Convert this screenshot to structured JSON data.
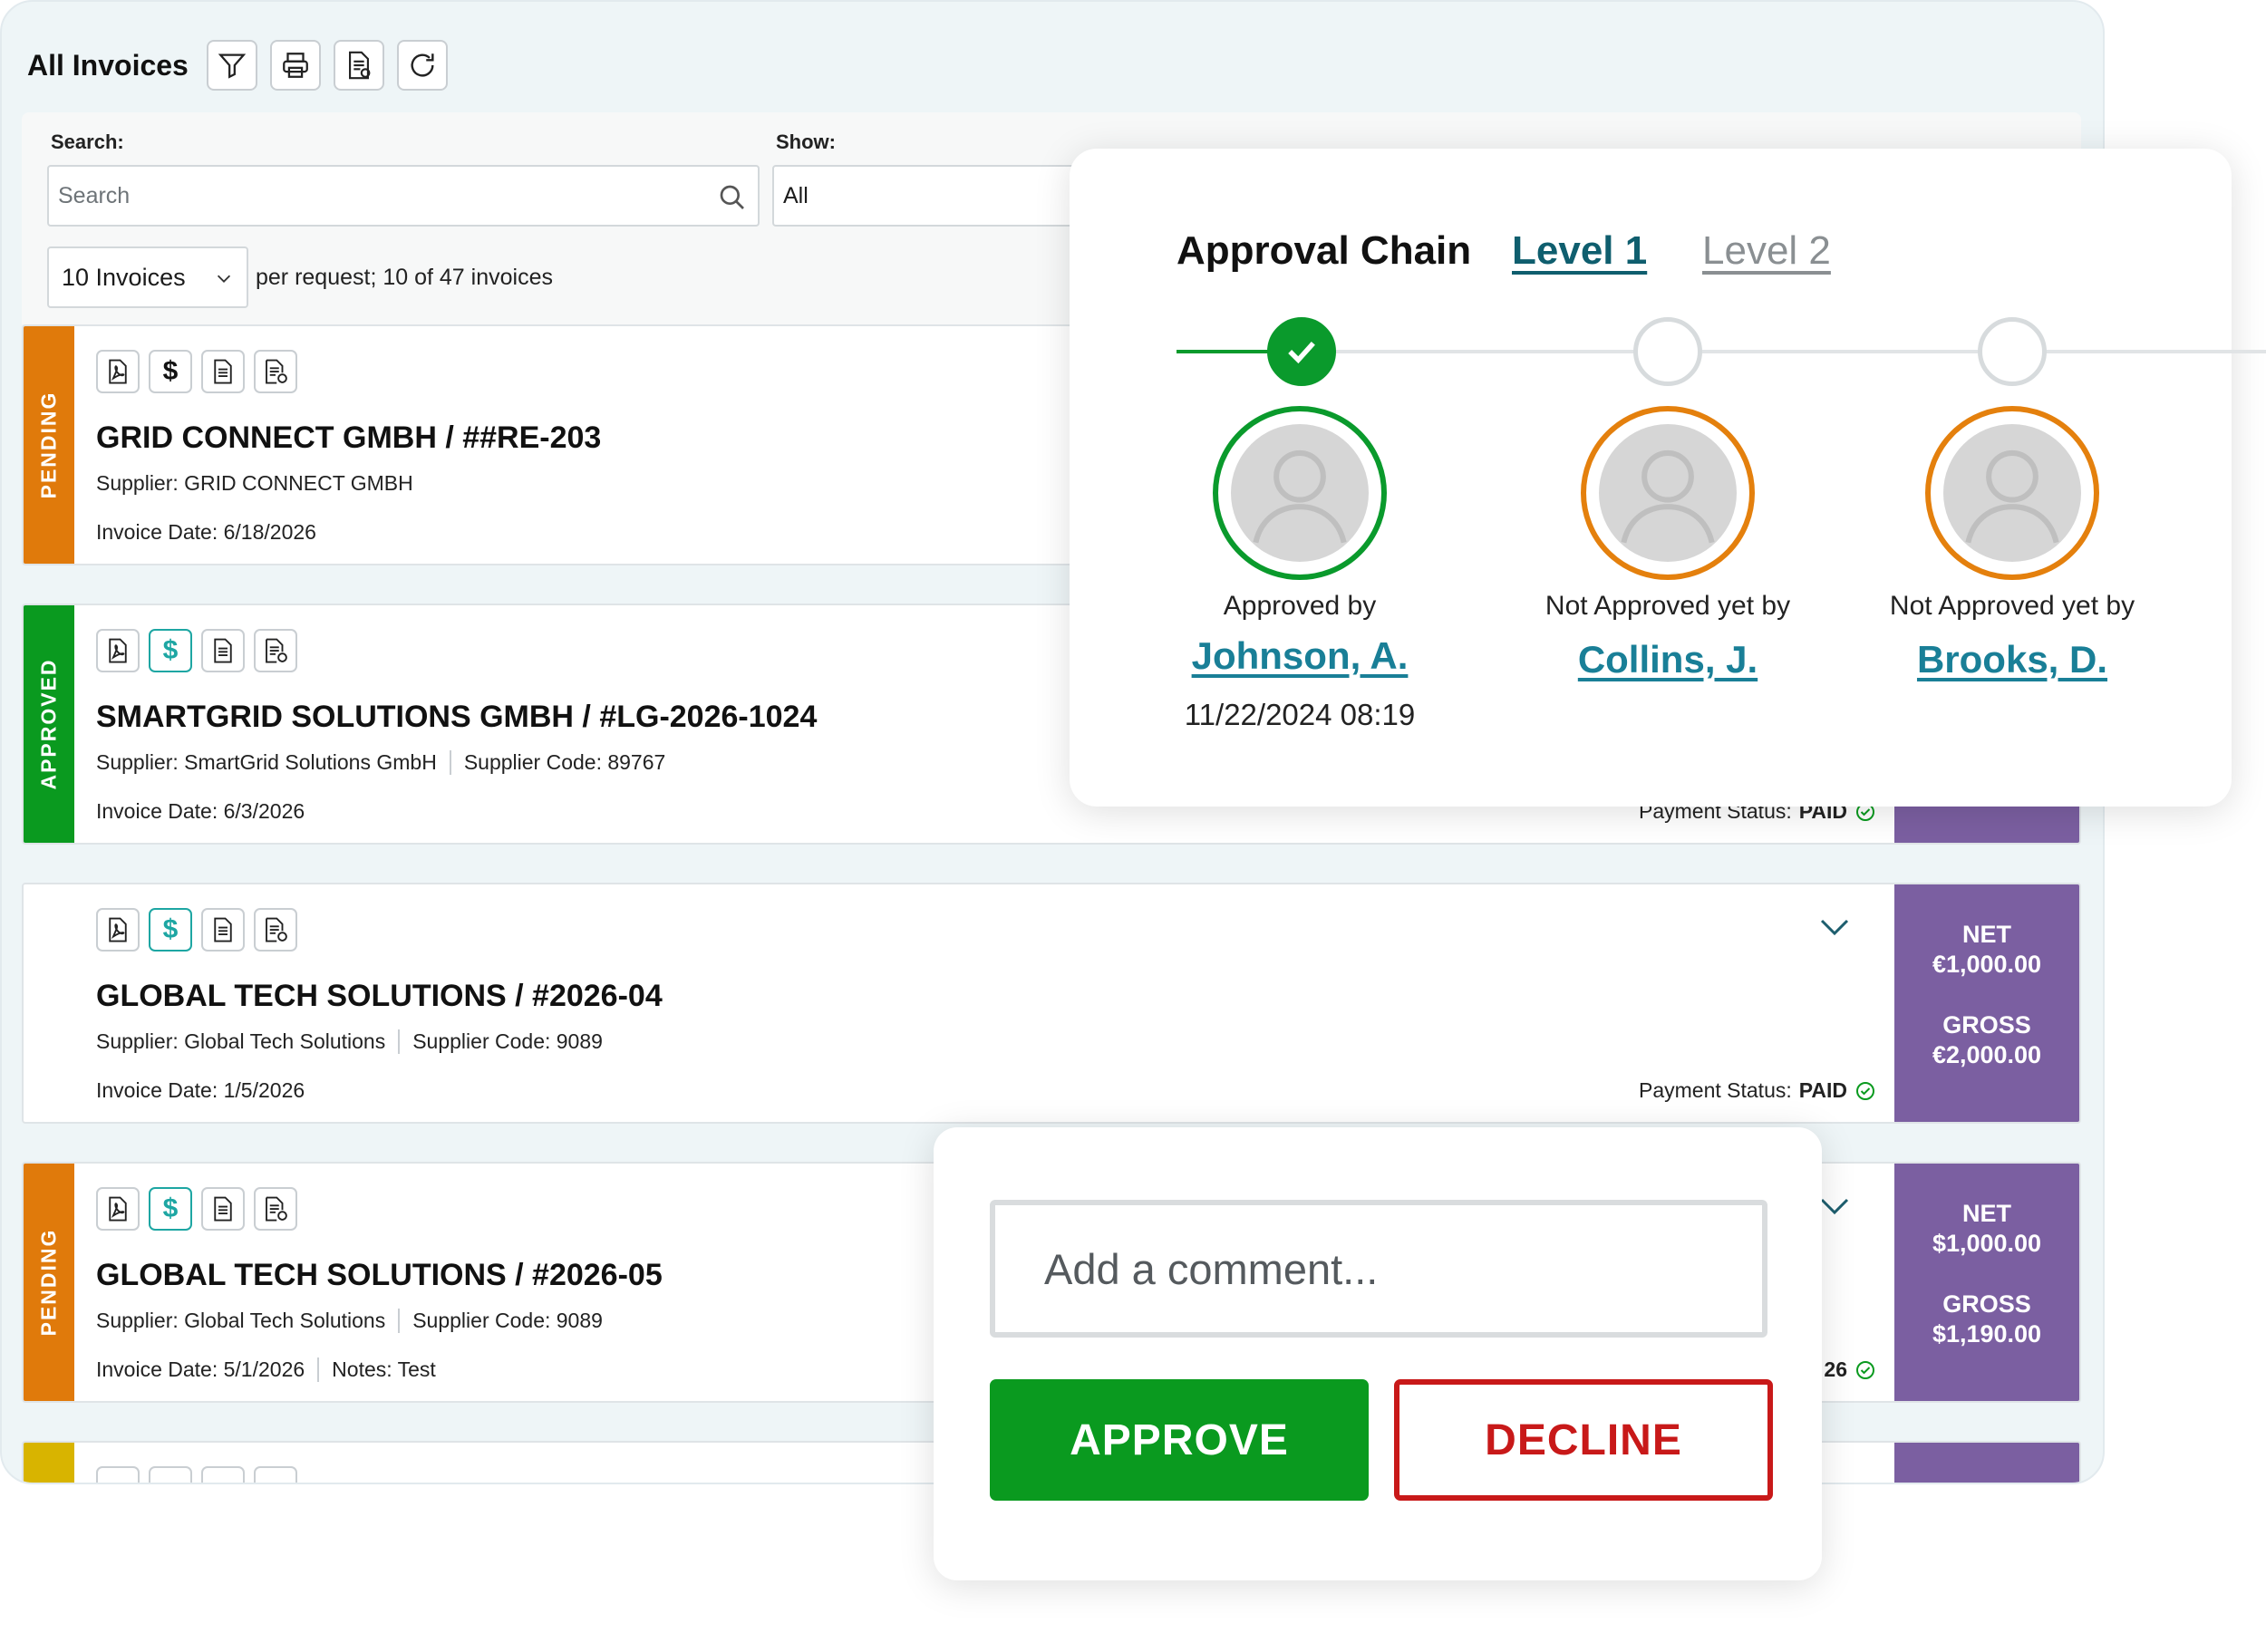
{
  "header": {
    "title": "All Invoices"
  },
  "toolbar_icons": [
    "filter-icon",
    "printer-icon",
    "export-document-icon",
    "refresh-icon"
  ],
  "filters": {
    "search_label": "Search:",
    "search_placeholder": "Search",
    "show_label": "Show:",
    "show_value": "All",
    "per_page_value": "10 Invoices",
    "per_page_info": "per request; 10 of 47 invoices"
  },
  "colors": {
    "pending": "#e07a0b",
    "approved": "#0a9a1f",
    "amount_panel": "#7b5fa1",
    "accent_teal": "#1da6a3",
    "link": "#197f97",
    "decline": "#c81919"
  },
  "invoices": [
    {
      "status": "PENDING",
      "title": "GRID CONNECT GMBH / ##RE-203",
      "supplier": "Supplier: GRID CONNECT GMBH",
      "invoice_date": "Invoice Date: 6/18/2026"
    },
    {
      "status": "APPROVED",
      "title": "SMARTGRID SOLUTIONS GMBH / #LG-2026-1024",
      "supplier": "Supplier: SmartGrid Solutions GmbH",
      "supplier_code": "Supplier Code: 89767",
      "invoice_date": "Invoice Date: 6/3/2026",
      "payment_label": "Payment Status:",
      "payment_value": "PAID"
    },
    {
      "status": "",
      "title": "GLOBAL TECH SOLUTIONS / #2026-04",
      "supplier": "Supplier: Global Tech Solutions",
      "supplier_code": "Supplier Code: 9089",
      "invoice_date": "Invoice Date: 1/5/2026",
      "payment_label": "Payment Status:",
      "payment_value": "PAID",
      "net_label": "NET",
      "net_value": "€1,000.00",
      "gross_label": "GROSS",
      "gross_value": "€2,000.00"
    },
    {
      "status": "PENDING",
      "title": "GLOBAL TECH SOLUTIONS / #2026-05",
      "supplier": "Supplier: Global Tech Solutions",
      "supplier_code": "Supplier Code: 9089",
      "invoice_date": "Invoice Date: 5/1/2026",
      "notes": "Notes: Test",
      "payment_partial": "26",
      "net_label": "NET",
      "net_value": "$1,000.00",
      "gross_label": "GROSS",
      "gross_value": "$1,190.00"
    }
  ],
  "approval": {
    "title": "Approval Chain",
    "tab_active": "Level 1",
    "tab_inactive": "Level 2",
    "approvers": [
      {
        "state": "Approved by",
        "name": "Johnson, A.",
        "date": "11/22/2024 08:19"
      },
      {
        "state": "Not Approved yet by",
        "name": "Collins, J."
      },
      {
        "state": "Not Approved yet by",
        "name": "Brooks, D."
      }
    ]
  },
  "comment": {
    "placeholder": "Add a comment...",
    "approve_label": "APPROVE",
    "decline_label": "DECLINE"
  }
}
